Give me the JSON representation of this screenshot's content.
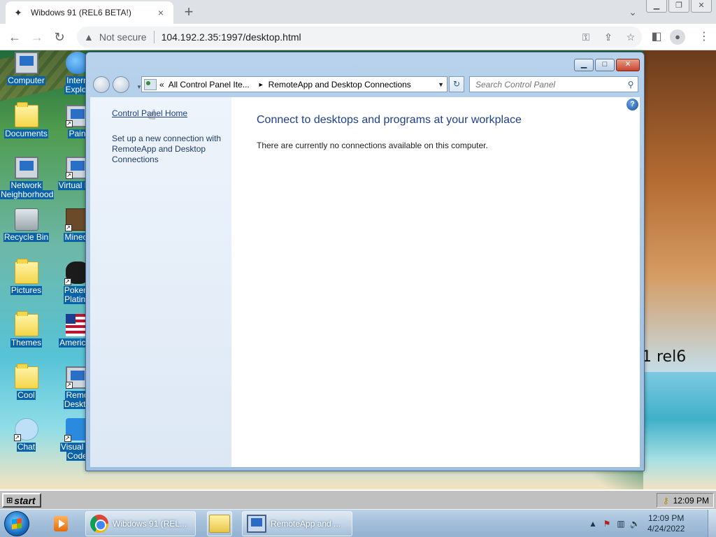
{
  "browser": {
    "tab_title": "Wibdows 91 (REL6 BETA!)",
    "tab_close": "×",
    "new_tab": "+",
    "security_label": "Not secure",
    "url": "104.192.2.35:1997/desktop.html"
  },
  "desktop": {
    "wallpaper_text": "1 rel6",
    "icons_left": [
      {
        "label_1": "Computer",
        "label_2": ""
      },
      {
        "label_1": "Documents",
        "label_2": ""
      },
      {
        "label_1": "Network",
        "label_2": "Neighborhood"
      },
      {
        "label_1": "Recycle Bin",
        "label_2": ""
      },
      {
        "label_1": "Pictures",
        "label_2": ""
      },
      {
        "label_1": "Themes",
        "label_2": ""
      },
      {
        "label_1": "Cool",
        "label_2": ""
      },
      {
        "label_1": "Chat",
        "label_2": ""
      }
    ],
    "icons_right": [
      {
        "label_1": "Intern",
        "label_2": "Explor"
      },
      {
        "label_1": "Pain",
        "label_2": ""
      },
      {
        "label_1": "Virtual Ma",
        "label_2": ""
      },
      {
        "label_1": "Minecr",
        "label_2": ""
      },
      {
        "label_1": "Pokem",
        "label_2": "Platinu"
      },
      {
        "label_1": "American",
        "label_2": ""
      },
      {
        "label_1": "Remo",
        "label_2": "Deskto"
      },
      {
        "label_1": "Visual St",
        "label_2": "Code"
      }
    ]
  },
  "control_panel": {
    "breadcrumb_prefix": "«",
    "breadcrumb_1": "All Control Panel Ite...",
    "breadcrumb_sep": "►",
    "breadcrumb_2": "RemoteApp and Desktop Connections",
    "search_placeholder": "Search Control Panel",
    "left_link": "Control Panel Home",
    "left_task": "Set up a new connection with RemoteApp and Desktop Connections",
    "heading": "Connect to desktops and programs at your workplace",
    "message": "There are currently no connections available on this computer.",
    "help": "?"
  },
  "taskbar91": {
    "start_label": "start",
    "clock": "12:09 PM"
  },
  "taskbar7": {
    "chrome_label": "Wibdows 91 (REL...",
    "rdp_label": "RemoteApp and ...",
    "time": "12:09 PM",
    "date": "4/24/2022"
  }
}
